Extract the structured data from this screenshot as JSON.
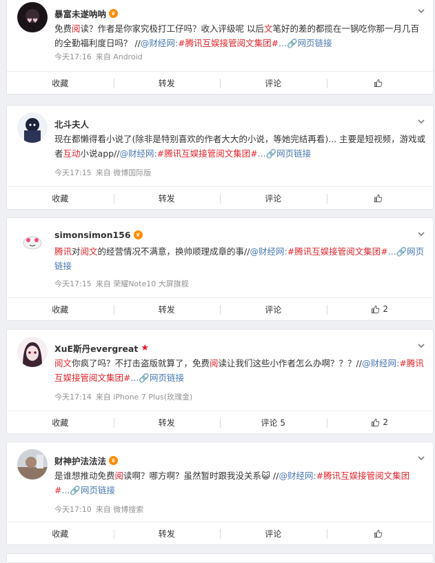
{
  "posts": [
    {
      "username": "暴富未遂呐呐",
      "badge": "vip",
      "segments": [
        {
          "t": "免费",
          "c": "n"
        },
        {
          "t": "阅",
          "c": "h"
        },
        {
          "t": "读？作者是你家究极打工仔吗？收入评级呢 以后",
          "c": "n"
        },
        {
          "t": "文",
          "c": "h"
        },
        {
          "t": "笔好的差的都揽在一锅吃你那一月几百的全勤福利度日吗？ //",
          "c": "n"
        },
        {
          "t": "@财经网",
          "c": "l"
        },
        {
          "t": ":",
          "c": "l"
        },
        {
          "t": "#腾讯互娱接管阅文集团#",
          "c": "h"
        },
        {
          "t": "...",
          "c": "l"
        },
        {
          "t": "🔗网页链接",
          "c": "l"
        }
      ],
      "time": "今天17:16",
      "source": "来自 Android",
      "actions": {
        "fav": "收藏",
        "repost": "转发",
        "comment": "评论",
        "like": ""
      }
    },
    {
      "username": "北斗夫人",
      "badge": "",
      "segments": [
        {
          "t": "现在都懒得看小说了(除非是特别喜欢的作者大大的小说，等她完结再看)... 主要是短视频，游戏或者",
          "c": "n"
        },
        {
          "t": "互动",
          "c": "h"
        },
        {
          "t": "小说app//",
          "c": "n"
        },
        {
          "t": "@财经网",
          "c": "l"
        },
        {
          "t": ":",
          "c": "l"
        },
        {
          "t": "#腾讯互娱接管阅文集团#",
          "c": "h"
        },
        {
          "t": "...",
          "c": "l"
        },
        {
          "t": "🔗网页链接",
          "c": "l"
        }
      ],
      "time": "今天17:15",
      "source": "来自 微博国际版",
      "actions": {
        "fav": "收藏",
        "repost": "转发",
        "comment": "评论",
        "like": ""
      }
    },
    {
      "username": "simonsimon156",
      "badge": "vip",
      "segments": [
        {
          "t": "腾讯",
          "c": "h"
        },
        {
          "t": "对",
          "c": "n"
        },
        {
          "t": "阅文",
          "c": "h"
        },
        {
          "t": "的经营情况不满意，换帅顺理成章的事//",
          "c": "n"
        },
        {
          "t": "@财经网",
          "c": "l"
        },
        {
          "t": ":",
          "c": "l"
        },
        {
          "t": "#腾讯互娱接管阅文集团#",
          "c": "h"
        },
        {
          "t": "...",
          "c": "l"
        },
        {
          "t": "🔗网页链接",
          "c": "l"
        }
      ],
      "time": "今天17:15",
      "source": "来自 荣耀Note10 大屏旗舰",
      "actions": {
        "fav": "收藏",
        "repost": "转发",
        "comment": "评论",
        "like": "2"
      }
    },
    {
      "username": "XuE斯丹evergreat",
      "badge": "star",
      "segments": [
        {
          "t": "阅文",
          "c": "h"
        },
        {
          "t": "你疯了吗？不打击盗版就算了，免费",
          "c": "n"
        },
        {
          "t": "阅",
          "c": "h"
        },
        {
          "t": "读让我们这些小作者怎么办啊？？？//",
          "c": "n"
        },
        {
          "t": "@财经网",
          "c": "l"
        },
        {
          "t": ":",
          "c": "l"
        },
        {
          "t": "#腾讯互娱接管阅文集团#",
          "c": "h"
        },
        {
          "t": "...",
          "c": "l"
        },
        {
          "t": "🔗网页链接",
          "c": "l"
        }
      ],
      "time": "今天17:14",
      "source": "来自 iPhone 7 Plus(玫瑰金)",
      "actions": {
        "fav": "收藏",
        "repost": "转发",
        "comment": "评论 5",
        "like": "2"
      }
    },
    {
      "username": "财神护法法法",
      "badge": "vip",
      "segments": [
        {
          "t": "是谁想推动免费",
          "c": "n"
        },
        {
          "t": "阅",
          "c": "h"
        },
        {
          "t": "读啊？哪方啊？虽然暂时跟我没关系😺 //",
          "c": "n"
        },
        {
          "t": "@财经网",
          "c": "l"
        },
        {
          "t": ":",
          "c": "l"
        },
        {
          "t": "#腾讯互娱接管阅文集团#",
          "c": "h"
        },
        {
          "t": "...",
          "c": "l"
        },
        {
          "t": "🔗网页链接",
          "c": "l"
        }
      ],
      "time": "今天17:10",
      "source": "来自 微博搜索",
      "actions": {
        "fav": "收藏",
        "repost": "转发",
        "comment": "评论",
        "like": ""
      }
    }
  ],
  "colors": {
    "highlight": "#e0242b",
    "link": "#4a79b4",
    "meta": "#939393"
  },
  "icons": {
    "more": "chevron-down-icon",
    "like": "thumbs-up-icon",
    "link": "link-icon",
    "badge_vip": "vip-crown-icon",
    "badge_star": "star-icon"
  }
}
